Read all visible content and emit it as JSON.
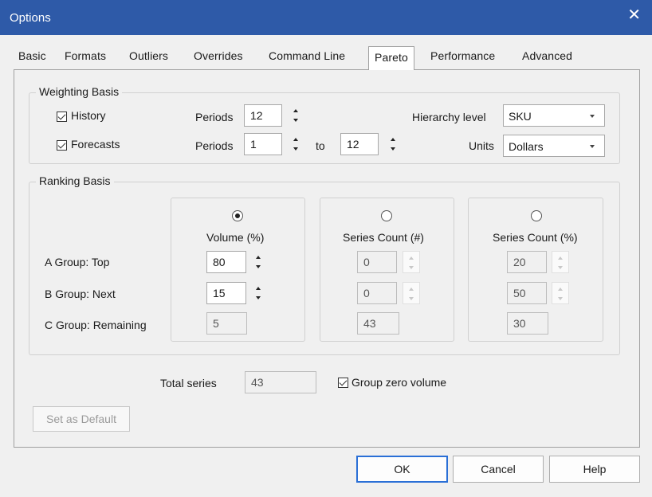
{
  "window": {
    "title": "Options",
    "close_glyph": "✕"
  },
  "tabs": [
    "Basic",
    "Formats",
    "Outliers",
    "Overrides",
    "Command Line",
    "Pareto",
    "Performance",
    "Advanced"
  ],
  "active_tab": "Pareto",
  "weighting": {
    "legend": "Weighting Basis",
    "history": {
      "label": "History",
      "checked": true
    },
    "forecasts": {
      "label": "Forecasts",
      "checked": true
    },
    "periods_label": "Periods",
    "history_periods": "12",
    "forecast_from": "1",
    "to_label": "to",
    "forecast_to": "12",
    "hierarchy_label": "Hierarchy level",
    "hierarchy_value": "SKU",
    "units_label": "Units",
    "units_value": "Dollars"
  },
  "ranking": {
    "legend": "Ranking Basis",
    "rows": {
      "a": "A Group: Top",
      "b": "B Group: Next",
      "c": "C Group: Remaining"
    },
    "volume": {
      "header": "Volume (%)",
      "selected": true,
      "a": "80",
      "b": "15",
      "c": "5"
    },
    "series_count": {
      "header": "Series Count (#)",
      "selected": false,
      "a": "0",
      "b": "0",
      "c": "43"
    },
    "series_pct": {
      "header": "Series Count (%)",
      "selected": false,
      "a": "20",
      "b": "50",
      "c": "30"
    }
  },
  "total": {
    "label": "Total series",
    "value": "43"
  },
  "group_zero": {
    "label": "Group zero volume",
    "checked": true
  },
  "buttons": {
    "set_default": "Set as Default",
    "ok": "OK",
    "cancel": "Cancel",
    "help": "Help"
  }
}
